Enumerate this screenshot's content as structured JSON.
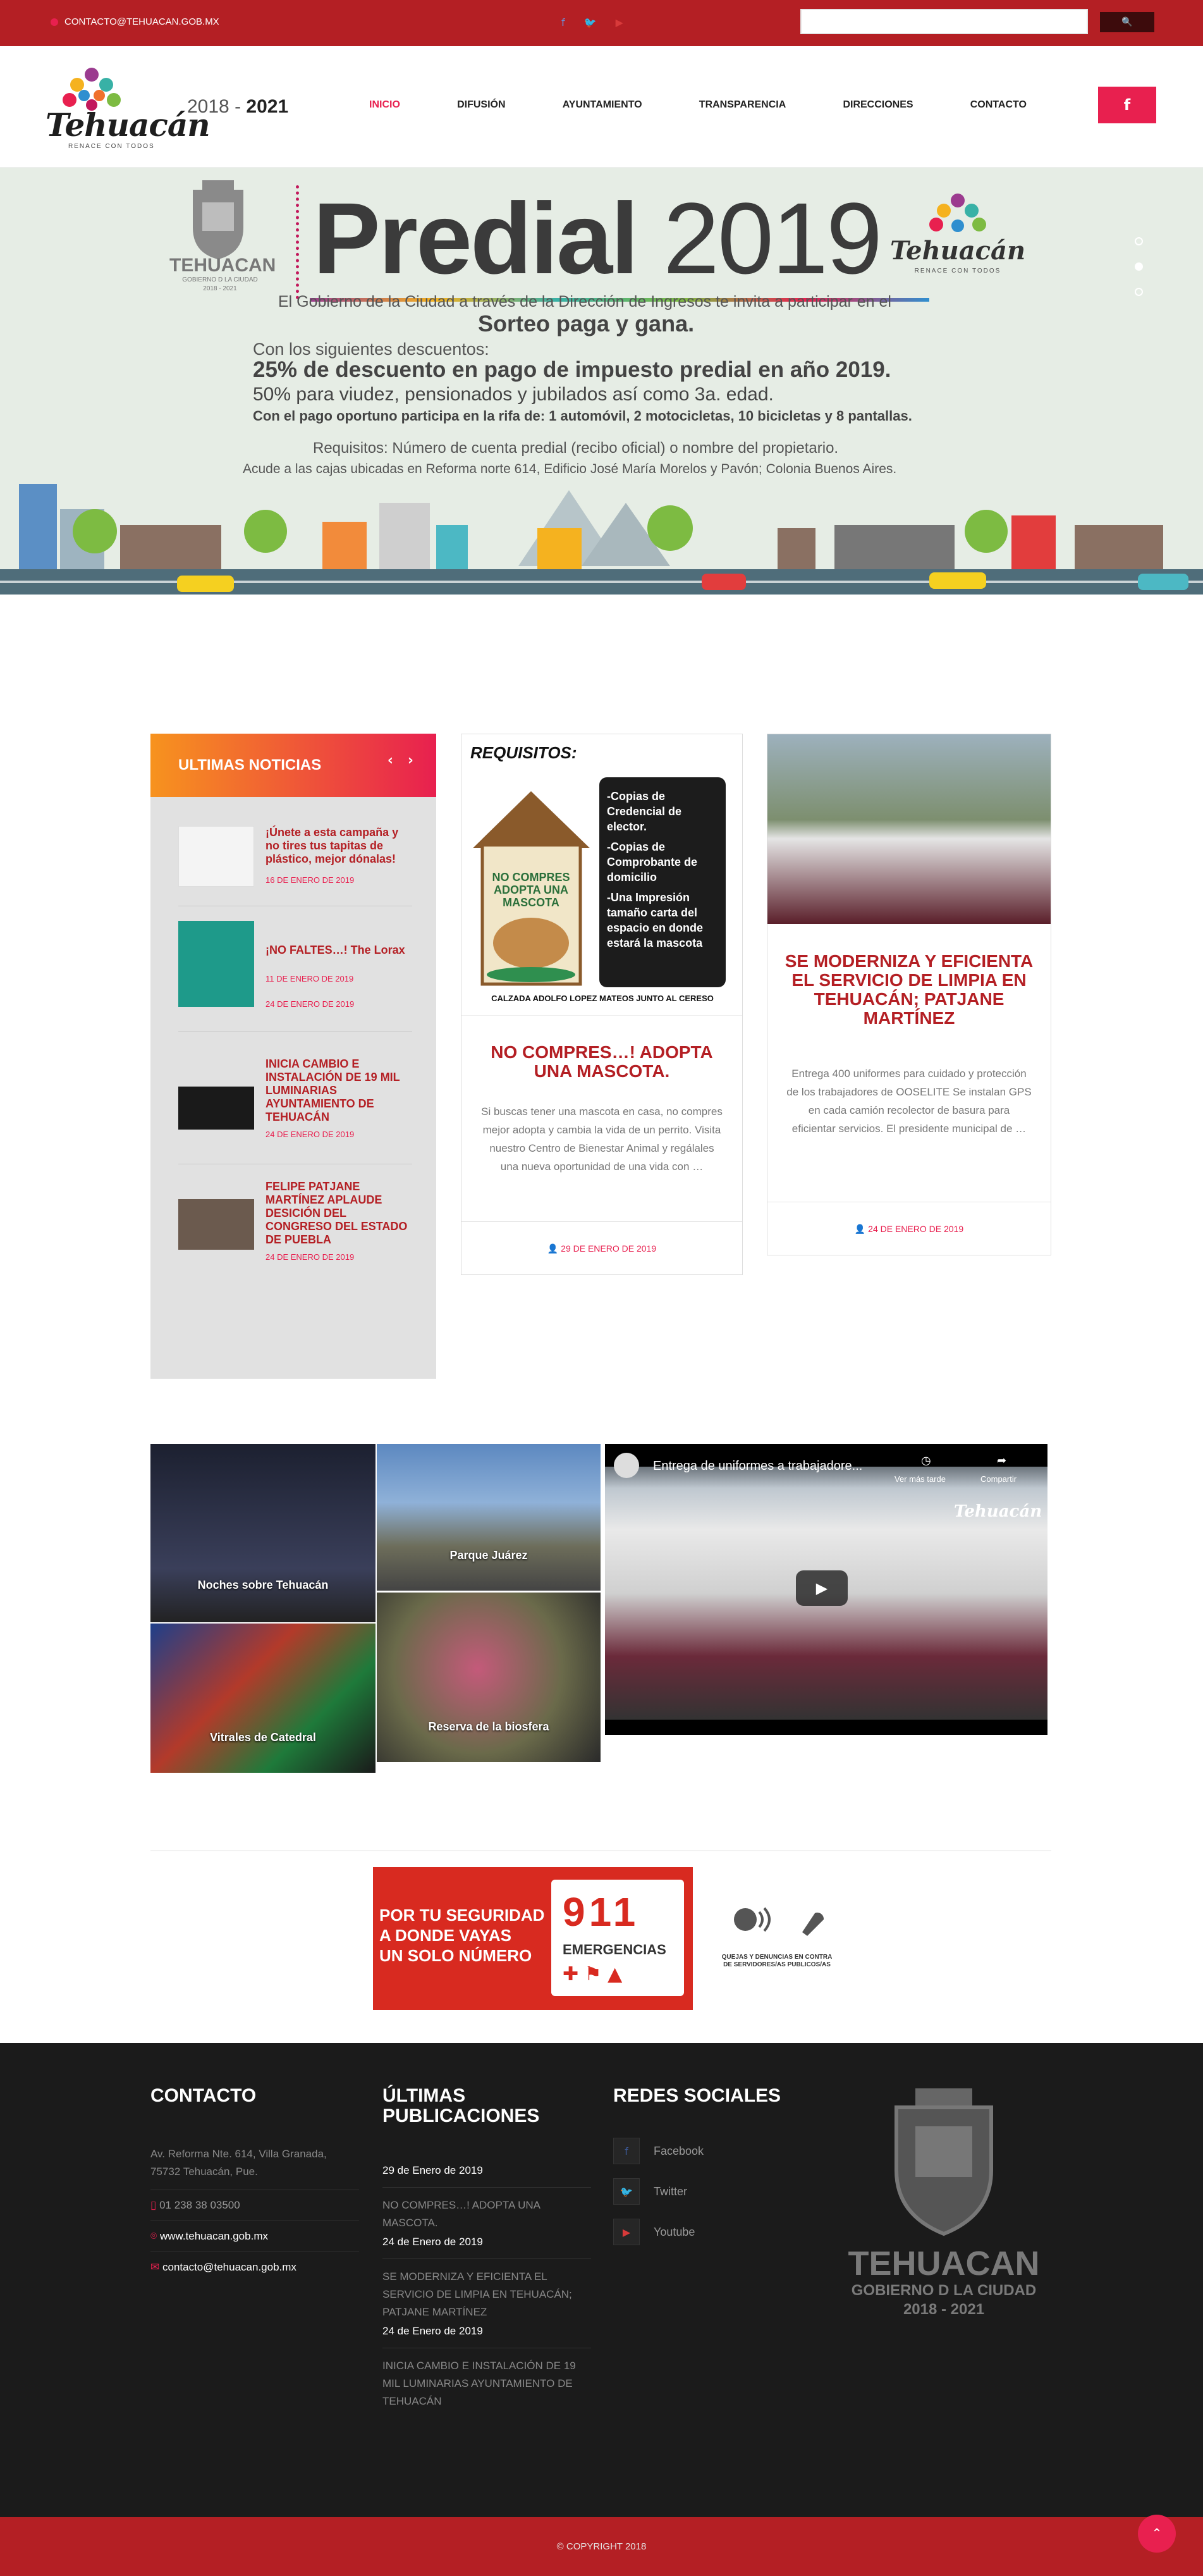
{
  "topbar": {
    "email": "CONTACTO@TEHUACAN.GOB.MX",
    "social_icons": [
      "facebook-icon",
      "twitter-icon",
      "youtube-icon"
    ],
    "search_placeholder": "",
    "search_button": "🔍"
  },
  "header": {
    "logo_word": "Tehuacán",
    "logo_sub": "RENACE CON TODOS",
    "years_start": "2018",
    "years_sep": " - ",
    "years_end": "2021",
    "nav": [
      {
        "label": "INICIO",
        "active": true
      },
      {
        "label": "DIFUSIÓN",
        "active": false
      },
      {
        "label": "AYUNTAMIENTO",
        "active": false
      },
      {
        "label": "TRANSPARENCIA",
        "active": false
      },
      {
        "label": "DIRECCIONES",
        "active": false
      },
      {
        "label": "CONTACTO",
        "active": false
      }
    ],
    "fb_button": "f"
  },
  "hero": {
    "title_a": "Predial",
    "title_b": "2019",
    "seal_name": "TEHUACAN",
    "seal_sub": "GOBIERNO D LA CIUDAD",
    "seal_years": "2018 - 2021",
    "logo_word": "Tehuacán",
    "logo_sub": "RENACE CON TODOS",
    "line1": "El Gobierno de la Ciudad a través de la Dirección de Ingresos te invita a participar en el",
    "line2": "Sorteo paga y gana.",
    "line3": "Con los siguientes descuentos:",
    "line4": "25% de descuento en pago de impuesto predial en año 2019.",
    "line5": "50% para viudez, pensionados y jubilados así como 3a. edad.",
    "line6": "Con el pago oportuno participa en la rifa de: 1 automóvil, 2 motocicletas, 10 bicicletas y 8 pantallas.",
    "line7": "Requisitos: Número de cuenta predial (recibo oficial) o nombre del propietario.",
    "line8": "Acude a las cajas ubicadas en Reforma norte 614, Edificio José María Morelos y Pavón; Colonia Buenos Aires.",
    "slides": 3,
    "active_slide": 1
  },
  "news": {
    "heading": "ULTIMAS NOTICIAS",
    "prev": "‹",
    "next": "›",
    "items": [
      {
        "title": "¡Únete a esta campaña y no tires tus tapitas de plástico, mejor dónalas!",
        "date": "16 DE ENERO DE 2019"
      },
      {
        "title": "¡NO FALTES…! The Lorax",
        "date": "11 DE ENERO DE 2019",
        "date2": "24 DE ENERO DE 2019"
      },
      {
        "title": "INICIA CAMBIO E INSTALACIÓN DE 19 MIL LUMINARIAS AYUNTAMIENTO DE TEHUACÁN",
        "date": "24 DE ENERO DE 2019"
      },
      {
        "title": "FELIPE PATJANE MARTÍNEZ APLAUDE DESICIÓN DEL CONGRESO DEL ESTADO DE PUEBLA",
        "date": "24 DE ENERO DE 2019"
      }
    ]
  },
  "cards": [
    {
      "title": "NO COMPRES…! ADOPTA UNA MASCOTA.",
      "text": "Si buscas tener una mascota en casa, no compres mejor adopta y cambia la vida de un perrito. Visita nuestro Centro de Bienestar Animal y regálales una nueva oportunidad de una vida con …",
      "date": "29 DE ENERO DE 2019",
      "poster": {
        "req": "REQUISITOS:",
        "badge": "NO COMPRES ADOPTA UNA MASCOTA",
        "list": [
          "-Copias de Credencial de elector.",
          "-Copias de Comprobante de domicilio",
          "-Una Impresión tamaño carta del espacio en donde estará la mascota"
        ],
        "address": "CALZADA ADOLFO LOPEZ MATEOS JUNTO AL CERESO"
      }
    },
    {
      "title": "SE MODERNIZA Y EFICIENTA EL SERVICIO DE LIMPIA EN TEHUACÁN; PATJANE MARTÍNEZ",
      "text": "Entrega 400 uniformes para cuidado y protección de los trabajadores de OOSELITE Se instalan GPS en cada camión recolector de basura para eficientar servicios. El presidente municipal de …",
      "date": "24 DE ENERO DE 2019"
    }
  ],
  "gallery": [
    {
      "caption": "Noches sobre Tehuacán"
    },
    {
      "caption": "Parque Juárez"
    },
    {
      "caption": "Vitrales de Catedral"
    },
    {
      "caption": "Reserva de la biosfera"
    }
  ],
  "video": {
    "title": "Entrega de uniformes a trabajadore...",
    "later": "Ver más tarde",
    "share": "Compartir",
    "watermark": "Tehuacán"
  },
  "banner911": {
    "line1": "POR TU SEGURIDAD",
    "line2": "A DONDE VAYAS",
    "line3": "UN SOLO NÚMERO",
    "number": "911",
    "label": "EMERGENCIAS"
  },
  "quejas": "QUEJAS Y DENUNCIAS EN CONTRA DE SERVIDORES/AS PUBLICOS/AS",
  "footer": {
    "contact_heading": "CONTACTO",
    "address": "Av. Reforma Nte. 614, Villa Granada, 75732 Tehuacán, Pue.",
    "phone": "01 238 38 03500",
    "web": "www.tehuacan.gob.mx",
    "email": "contacto@tehuacan.gob.mx",
    "pubs_heading": "ÚLTIMAS PUBLICACIONES",
    "pubs": [
      {
        "date": "29 de Enero de 2019",
        "title": "NO COMPRES…! ADOPTA UNA MASCOTA."
      },
      {
        "date": "24 de Enero de 2019",
        "title": "SE MODERNIZA Y EFICIENTA EL SERVICIO DE LIMPIA EN TEHUACÁN; PATJANE MARTÍNEZ"
      },
      {
        "date": "24 de Enero de 2019",
        "title": "INICIA CAMBIO E INSTALACIÓN DE 19 MIL LUMINARIAS AYUNTAMIENTO DE TEHUACÁN"
      }
    ],
    "social_heading": "REDES SOCIALES",
    "social": [
      {
        "icon": "f",
        "label": "Facebook"
      },
      {
        "icon": "🐦",
        "label": "Twitter"
      },
      {
        "icon": "▶",
        "label": "Youtube"
      }
    ],
    "seal_name": "TEHUACAN",
    "seal_sub": "GOBIERNO D LA CIUDAD",
    "seal_years": "2018 - 2021"
  },
  "copyright": "COPYRIGHT 2018",
  "to_top": "⌃",
  "colors": {
    "brand_red": "#b41f24",
    "accent_pink": "#e8204f",
    "footer_bg": "#1b1b1b",
    "hero_bg": "#e6ede5"
  }
}
